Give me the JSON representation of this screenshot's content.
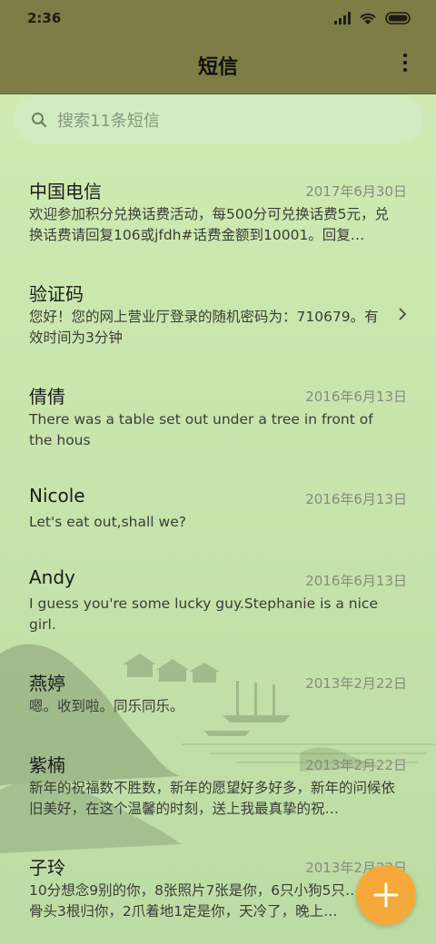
{
  "status_bar": {
    "time": "2:36"
  },
  "header": {
    "title": "短信"
  },
  "search": {
    "placeholder": "搜索11条短信"
  },
  "messages": [
    {
      "name": "中国电信",
      "date": "2017年6月30日",
      "preview": "欢迎参加积分兑换话费活动，每500分可兑换话费5元，兑换话费请回复106或jfdh#话费金额到10001。回复…"
    },
    {
      "name": "验证码",
      "date": "",
      "preview": "您好！您的网上营业厅登录的随机密码为：710679。有效时间为3分钟"
    },
    {
      "name": "倩倩",
      "date": "2016年6月13日",
      "preview": "There was a table set out under a tree in front of the hous"
    },
    {
      "name": "Nicole",
      "date": "2016年6月13日",
      "preview": "Let's eat out,shall we?"
    },
    {
      "name": "Andy",
      "date": "2016年6月13日",
      "preview": "I guess you're some lucky guy.Stephanie is a nice girl."
    },
    {
      "name": "燕婷",
      "date": "2013年2月22日",
      "preview": "嗯。收到啦。同乐同乐。"
    },
    {
      "name": "紫楠",
      "date": "2013年2月22日",
      "preview": "新年的祝福数不胜数，新年的愿望好多好多，新年的问候依旧美好，在这个温馨的时刻，送上我最真挚的祝…"
    },
    {
      "name": "子玲",
      "date": "2013年2月22日",
      "preview": "10分想念9别的你，8张照片7张是你，6只小狗5只…4根骨头3根归你，2爪着地1定是你，天冷了，晚上…"
    }
  ],
  "colors": {
    "header": "#7f7d46",
    "fab": "#f5a93a",
    "background": "#c9e6ad"
  }
}
